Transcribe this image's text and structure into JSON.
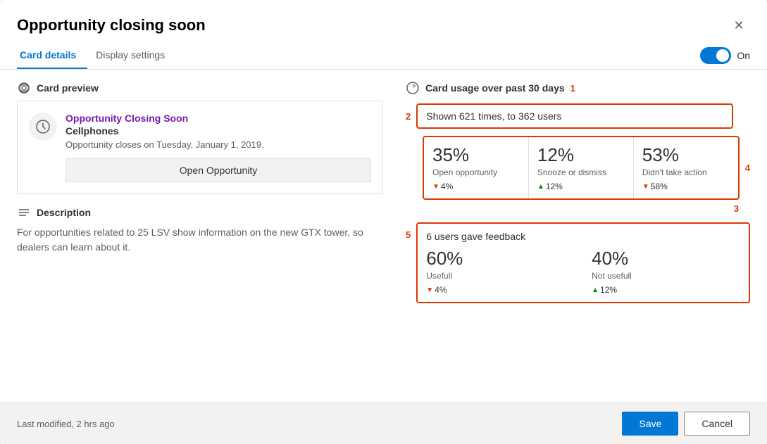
{
  "dialog": {
    "title": "Opportunity closing soon",
    "close_label": "✕"
  },
  "tabs": {
    "items": [
      {
        "label": "Card details",
        "active": true
      },
      {
        "label": "Display settings",
        "active": false
      }
    ],
    "toggle_label": "On"
  },
  "card_preview": {
    "section_label": "Card preview",
    "card": {
      "title": "Opportunity Closing Soon",
      "subtitle": "Cellphones",
      "description": "Opportunity closes on Tuesday, January 1, 2019.",
      "action_label": "Open Opportunity"
    }
  },
  "description": {
    "label": "Description",
    "text": "For opportunities related to 25 LSV show information on the new GTX tower, so dealers can learn about it."
  },
  "usage": {
    "section_label": "Card usage over past 30 days",
    "annotation_1": "1",
    "shown_text": "Shown 621 times, to 362 users",
    "annotation_2": "2",
    "annotation_3": "3",
    "annotation_4": "4",
    "annotation_5": "5",
    "stats": [
      {
        "pct": "35%",
        "label": "Open opportunity",
        "change": "▼ 4%",
        "change_dir": "down"
      },
      {
        "pct": "12%",
        "label": "Snooze or dismiss",
        "change": "▲ 12%",
        "change_dir": "up"
      },
      {
        "pct": "53%",
        "label": "Didn't take action",
        "change": "▼ 58%",
        "change_dir": "down"
      }
    ],
    "feedback": {
      "title": "6 users gave feedback",
      "items": [
        {
          "pct": "60%",
          "label": "Usefull",
          "change": "▼ 4%",
          "change_dir": "down"
        },
        {
          "pct": "40%",
          "label": "Not usefull",
          "change": "▲ 12%",
          "change_dir": "up"
        }
      ]
    }
  },
  "footer": {
    "modified_text": "Last modified, 2 hrs ago",
    "save_label": "Save",
    "cancel_label": "Cancel"
  }
}
